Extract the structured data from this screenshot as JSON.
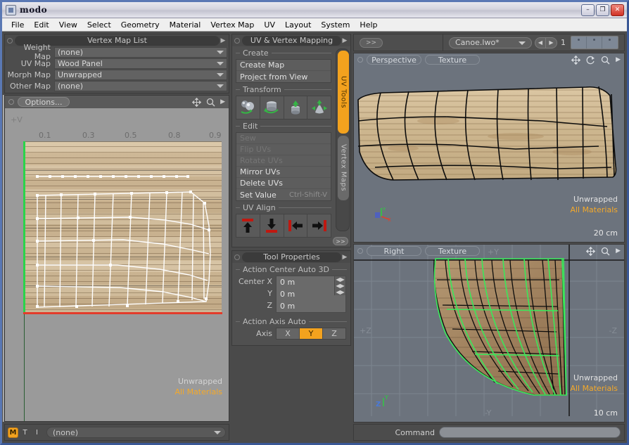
{
  "window": {
    "title": "modo",
    "icon": "app-icon",
    "buttons": {
      "minimize": "–",
      "maximize": "❐",
      "close": "✕"
    }
  },
  "menubar": {
    "items": [
      "File",
      "Edit",
      "View",
      "Select",
      "Geometry",
      "Material",
      "Vertex Map",
      "UV",
      "Layout",
      "System",
      "Help"
    ]
  },
  "vertex_map_list": {
    "title": "Vertex Map List",
    "rows": [
      {
        "label": "Weight Map",
        "value": "(none)"
      },
      {
        "label": "UV Map",
        "value": "Wood Panel"
      },
      {
        "label": "Morph Map",
        "value": "Unwrapped"
      },
      {
        "label": "Other Map",
        "value": "(none)"
      }
    ]
  },
  "uv_viewport": {
    "options_button": "Options...",
    "axis_label": "+V",
    "ticks": [
      "0.1",
      "0.3",
      "0.5",
      "0.8",
      "0.9"
    ],
    "status_line1": "Unwrapped",
    "status_line2": "All Materials",
    "icons": [
      "pan-icon",
      "zoom-icon",
      "chevron-right-icon"
    ]
  },
  "material_bar": {
    "toggles": [
      "M",
      "T",
      "I"
    ],
    "active_toggle": "M",
    "value": "(none)"
  },
  "uv_mapping_panel": {
    "title": "UV & Vertex Mapping",
    "groups": {
      "create": {
        "label": "Create",
        "items": [
          "Create Map",
          "Project from View"
        ]
      },
      "transform": {
        "label": "Transform",
        "tools": [
          "uv-move-tool",
          "uv-rotate-tool",
          "uv-scale-tool",
          "uv-falloff-tool"
        ]
      },
      "edit": {
        "label": "Edit",
        "items": [
          {
            "label": "Sew",
            "shortcut": "",
            "enabled": false
          },
          {
            "label": "Flip UVs",
            "shortcut": "",
            "enabled": false
          },
          {
            "label": "Rotate UVs",
            "shortcut": "",
            "enabled": false
          },
          {
            "label": "Mirror UVs",
            "shortcut": "",
            "enabled": true
          },
          {
            "label": "Delete UVs",
            "shortcut": "",
            "enabled": true
          },
          {
            "label": "Set Value",
            "shortcut": "Ctrl-Shift-V",
            "enabled": true
          }
        ]
      },
      "uv_align": {
        "label": "UV Align",
        "buttons": [
          "align-top-icon",
          "align-bottom-icon",
          "align-left-icon",
          "align-right-icon"
        ]
      }
    },
    "vertical_tabs": [
      {
        "label": "UV Tools",
        "active": true
      },
      {
        "label": "Vertex Maps",
        "active": false
      }
    ],
    "more_button": ">>"
  },
  "tool_properties": {
    "title": "Tool Properties",
    "action_center": {
      "label": "Action Center Auto 3D",
      "fields": [
        {
          "label": "Center X",
          "value": "0 m"
        },
        {
          "label": "Y",
          "value": "0 m"
        },
        {
          "label": "Z",
          "value": "0 m"
        }
      ]
    },
    "action_axis": {
      "label": "Action Axis Auto",
      "field_label": "Axis",
      "options": [
        "X",
        "Y",
        "Z"
      ],
      "selected": "Y"
    }
  },
  "toolbar": {
    "expand_button": ">>",
    "file_name": "Canoe.lwo*",
    "prev_arrow": "◀",
    "next_arrow": "▶",
    "layer_number": "1"
  },
  "viewport_perspective": {
    "view_label": "Perspective",
    "shading_label": "Texture",
    "status_line1": "Unwrapped",
    "status_line2": "All Materials",
    "scale": "20 cm",
    "icons": [
      "pan-icon",
      "rotate-icon",
      "zoom-icon",
      "chevron-right-icon"
    ],
    "gizmo_axes": [
      "X",
      "Y",
      "Z"
    ]
  },
  "viewport_right": {
    "view_label": "Right",
    "shading_label": "Texture",
    "status_line1": "Unwrapped",
    "status_line2": "All Materials",
    "scale": "10 cm",
    "axis_labels": {
      "plus_z": "+Z",
      "minus_z": "-Z",
      "plus_y": "+Y",
      "minus_y": "-Y"
    },
    "icons": [
      "pan-icon",
      "zoom-icon",
      "chevron-right-icon"
    ],
    "gizmo_axes": [
      "Z",
      "Y"
    ]
  },
  "command_bar": {
    "label": "Command",
    "value": ""
  },
  "colors": {
    "accent_orange": "#f3a21e",
    "panel_bg": "#505050",
    "viewport_bg": "#6c737d",
    "uv_bg": "#9a9a9a",
    "selection_green": "#2ad44a",
    "boundary_red": "#e33b2a"
  }
}
